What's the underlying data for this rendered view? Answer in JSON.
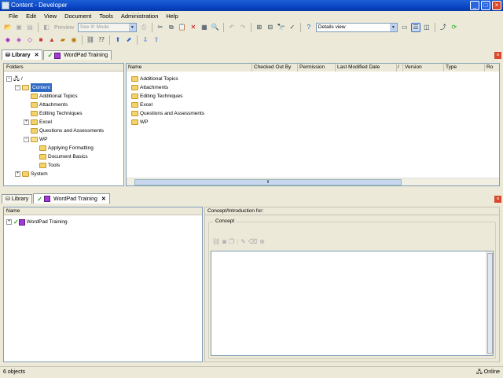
{
  "window": {
    "title": "Content - Developer"
  },
  "menu": [
    "File",
    "Edit",
    "View",
    "Document",
    "Tools",
    "Administration",
    "Help"
  ],
  "toolbar": {
    "preview_label": "Preview",
    "mode_select": "See It! Mode",
    "view_select": "Details view"
  },
  "top_tabs": [
    {
      "label": "Library",
      "active": true
    },
    {
      "label": "WordPad Training",
      "active": false
    }
  ],
  "folders_header": "Folders",
  "tree": [
    {
      "label": "/",
      "level": 0
    },
    {
      "label": "Content",
      "level": 1,
      "selected": true
    },
    {
      "label": "Additional Topics",
      "level": 2
    },
    {
      "label": "Attachments",
      "level": 2
    },
    {
      "label": "Editing Techniques",
      "level": 2
    },
    {
      "label": "Excel",
      "level": 2
    },
    {
      "label": "Questions and Assessments",
      "level": 2
    },
    {
      "label": "WP",
      "level": 2
    },
    {
      "label": "Applying Formatting",
      "level": 3
    },
    {
      "label": "Document Basics",
      "level": 3
    },
    {
      "label": "Tools",
      "level": 3
    },
    {
      "label": "System",
      "level": 1
    }
  ],
  "columns": [
    "Name",
    "Checked Out By",
    "Permission",
    "Last Modified Date",
    "Version",
    "Type",
    "Ro"
  ],
  "sort_indicator": "/",
  "files": [
    "Additional Topics",
    "Attachments",
    "Editing Techniques",
    "Excel",
    "Questions and Assessments",
    "WP"
  ],
  "bottom_tabs": [
    {
      "label": "Library",
      "active": false
    },
    {
      "label": "WordPad Training",
      "active": true
    }
  ],
  "outline": {
    "header": "Name",
    "item": "WordPad Training"
  },
  "concept": {
    "header": "Concept/Introduction for:",
    "group_label": "Concept"
  },
  "status": {
    "count": "6 objects",
    "connection": "Online"
  }
}
